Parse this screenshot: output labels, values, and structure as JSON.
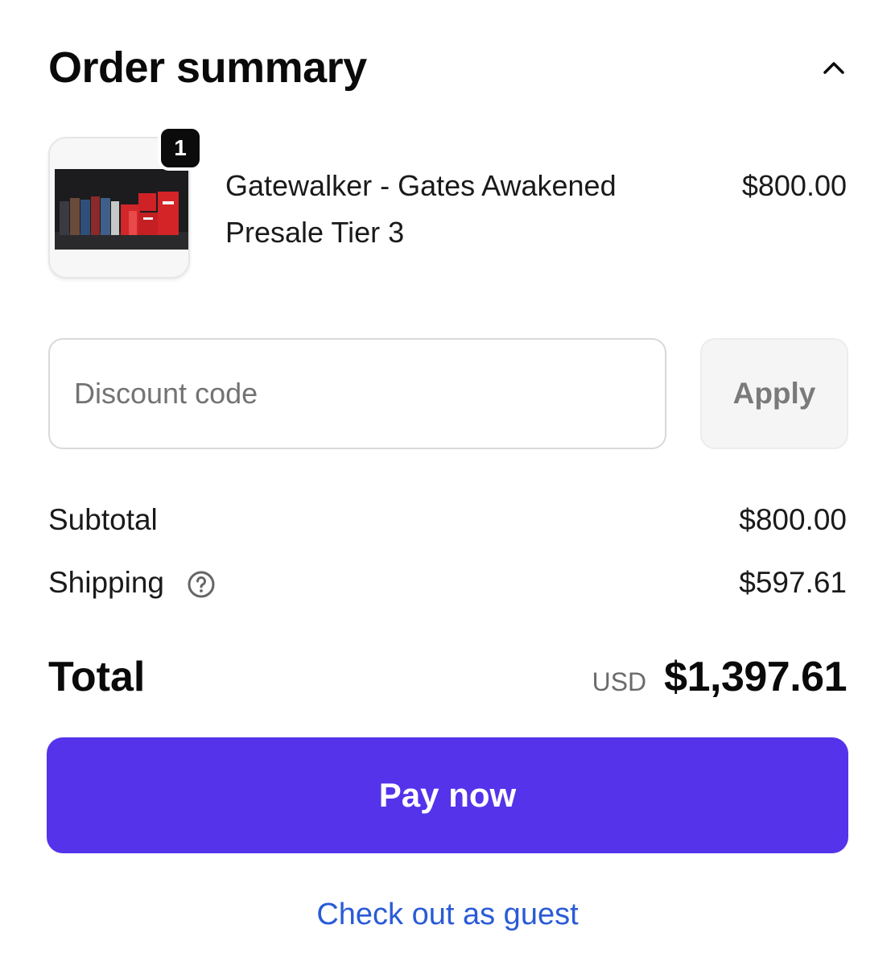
{
  "header": {
    "title": "Order summary",
    "toggle_icon": "chevron-up-icon"
  },
  "product": {
    "quantity": "1",
    "name_line1": "Gatewalker - Gates Awakened",
    "name_line2": "Presale Tier 3",
    "price": "$800.00",
    "thumbnail_icon": "product-image"
  },
  "discount": {
    "placeholder": "Discount code",
    "apply_label": "Apply"
  },
  "summary": {
    "subtotal_label": "Subtotal",
    "subtotal_value": "$800.00",
    "shipping_label": "Shipping",
    "shipping_value": "$597.61",
    "shipping_help_icon": "question-circle-icon"
  },
  "total": {
    "label": "Total",
    "currency": "USD",
    "value": "$1,397.61"
  },
  "actions": {
    "pay_label": "Pay now",
    "guest_label": "Check out as guest"
  },
  "colors": {
    "primary_button": "#5433eb",
    "link": "#2a5bd7",
    "badge": "#0b0b0b"
  }
}
